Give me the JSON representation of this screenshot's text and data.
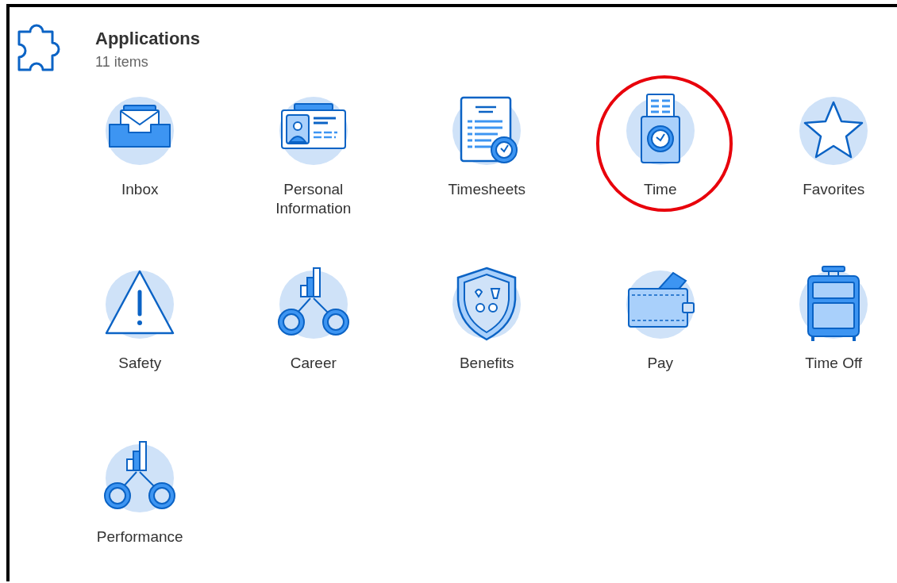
{
  "header": {
    "title": "Applications",
    "count": "11 items"
  },
  "apps": [
    {
      "label": "Inbox",
      "kind": "inbox",
      "highlighted": false
    },
    {
      "label": "Personal Information",
      "kind": "idcard",
      "highlighted": false
    },
    {
      "label": "Timesheets",
      "kind": "timesheet",
      "highlighted": false
    },
    {
      "label": "Time",
      "kind": "timeclock",
      "highlighted": true
    },
    {
      "label": "Favorites",
      "kind": "star",
      "highlighted": false
    },
    {
      "label": "Safety",
      "kind": "warning",
      "highlighted": false
    },
    {
      "label": "Career",
      "kind": "orgchart",
      "highlighted": false
    },
    {
      "label": "Benefits",
      "kind": "shield",
      "highlighted": false
    },
    {
      "label": "Pay",
      "kind": "wallet",
      "highlighted": false
    },
    {
      "label": "Time Off",
      "kind": "suitcase",
      "highlighted": false
    },
    {
      "label": "Performance",
      "kind": "orgchart",
      "highlighted": false
    }
  ]
}
